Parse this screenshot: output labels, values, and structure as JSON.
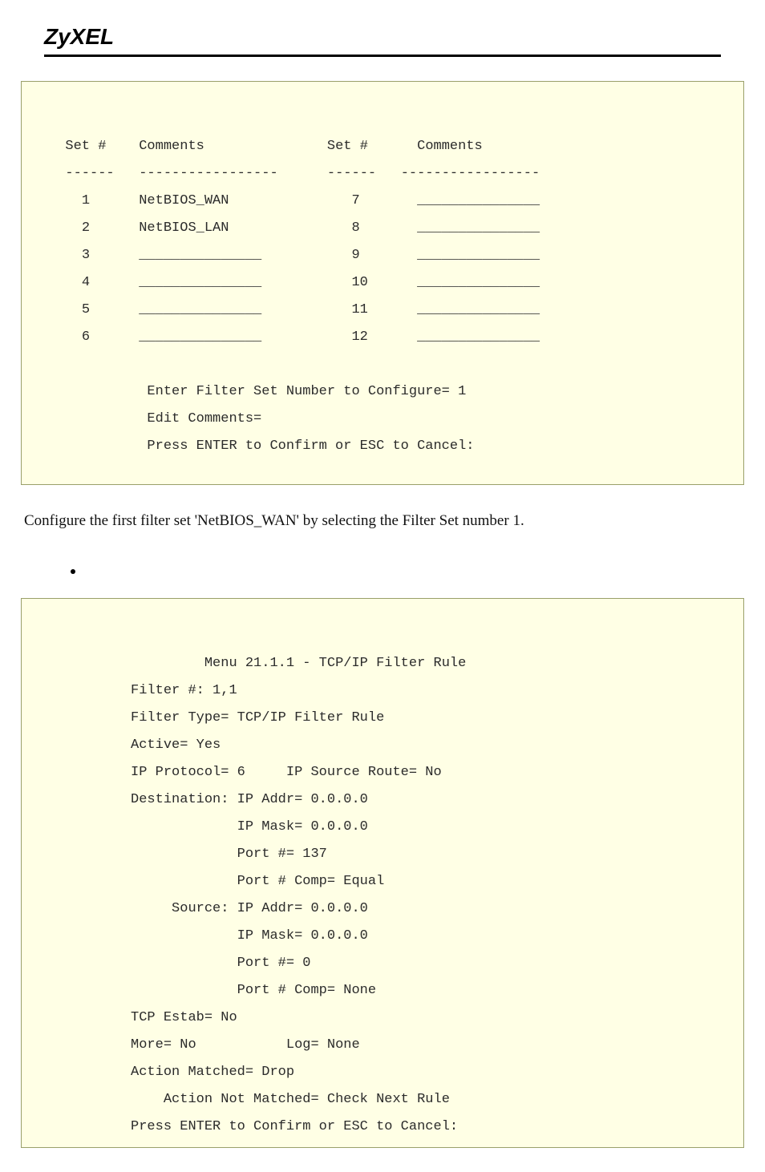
{
  "header": {
    "logo": "ZyXEL"
  },
  "filter_set_table": {
    "col1_hdr_set": "Set #",
    "col1_hdr_comments": "Comments",
    "col2_hdr_set": "Set #",
    "col2_hdr_comments": "Comments",
    "dash1a": "------",
    "dash1b": "-----------------",
    "dash2a": "------",
    "dash2b": "-----------------",
    "rows_left": [
      {
        "n": "1",
        "c": "NetBIOS_WAN"
      },
      {
        "n": "2",
        "c": "NetBIOS_LAN"
      },
      {
        "n": "3",
        "c": "_______________"
      },
      {
        "n": "4",
        "c": "_______________"
      },
      {
        "n": "5",
        "c": "_______________"
      },
      {
        "n": "6",
        "c": "_______________"
      }
    ],
    "rows_right": [
      {
        "n": "7",
        "c": "_______________"
      },
      {
        "n": "8",
        "c": "_______________"
      },
      {
        "n": "9",
        "c": "_______________"
      },
      {
        "n": "10",
        "c": "_______________"
      },
      {
        "n": "11",
        "c": "_______________"
      },
      {
        "n": "12",
        "c": "_______________"
      }
    ],
    "footer1": "Enter Filter Set Number to Configure= 1",
    "footer2": "Edit Comments=",
    "footer3": "Press ENTER to Confirm or ESC to Cancel:"
  },
  "instruction": "Configure the first filter set 'NetBIOS_WAN' by selecting the Filter Set number 1.",
  "rule_box": {
    "title": "         Menu 21.1.1 - TCP/IP Filter Rule",
    "l01": "Filter #: 1,1",
    "l02": "Filter Type= TCP/IP Filter Rule",
    "l03": "Active= Yes",
    "l04": "IP Protocol= 6     IP Source Route= No",
    "l05": "Destination: IP Addr= 0.0.0.0",
    "l06": "             IP Mask= 0.0.0.0",
    "l07": "             Port #= 137",
    "l08": "             Port # Comp= Equal",
    "l09": "     Source: IP Addr= 0.0.0.0",
    "l10": "             IP Mask= 0.0.0.0",
    "l11": "             Port #= 0",
    "l12": "             Port # Comp= None",
    "l13": "TCP Estab= No",
    "l14": "More= No           Log= None",
    "l15": "Action Matched= Drop",
    "l16": "    Action Not Matched= Check Next Rule",
    "l17": "Press ENTER to Confirm or ESC to Cancel:"
  }
}
